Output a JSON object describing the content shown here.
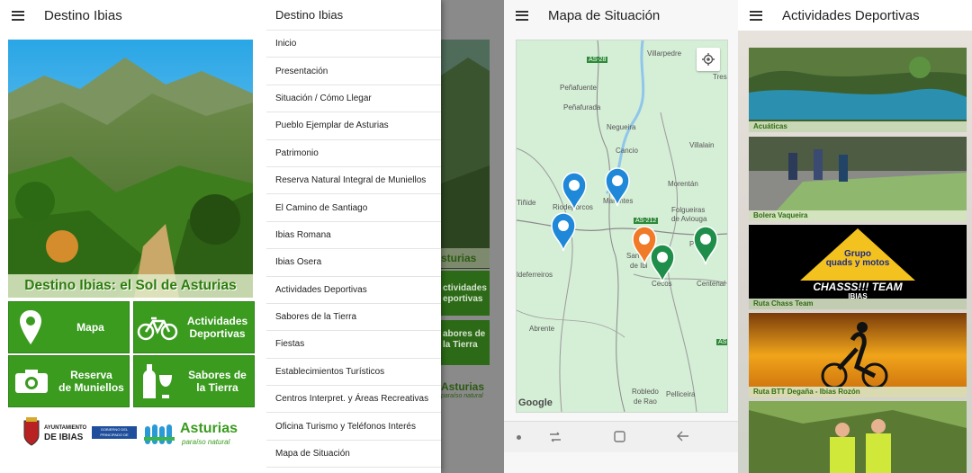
{
  "screen1": {
    "title": "Destino Ibias",
    "hero_caption": "Destino Ibias: el Sol de Asturias",
    "buttons": [
      {
        "label_line1": "Mapa",
        "label_line2": "",
        "icon": "map-marker-icon"
      },
      {
        "label_line1": "Actividades",
        "label_line2": "Deportivas",
        "icon": "bicycle-icon"
      },
      {
        "label_line1": "Reserva",
        "label_line2": "de Muniellos",
        "icon": "camera-icon"
      },
      {
        "label_line1": "Sabores de",
        "label_line2": "la Tierra",
        "icon": "bottle-glass-icon"
      }
    ],
    "logos": {
      "ayuntamiento_line1": "AYUNTAMIENTO",
      "ayuntamiento_line2": "DE IBIAS",
      "gobierno_line1": "GOBIERNO DEL",
      "gobierno_line2": "PRINCIPADO DE ASTURIAS",
      "asturias": "Asturias",
      "asturias_sub": "paraíso natural"
    },
    "colors": {
      "button_green": "#3a9b1f",
      "caption_green": "#2e7d0f"
    }
  },
  "screen2": {
    "drawer_title": "Destino Ibias",
    "menu_items": [
      "Inicio",
      "Presentación",
      "Situación / Cómo Llegar",
      "Pueblo Ejemplar de Asturias",
      "Patrimonio",
      "Reserva Natural Integral de Muniellos",
      "El Camino de Santiago",
      "Ibias Romana",
      "Ibias Osera",
      "Actividades Deportivas",
      "Sabores de la Tierra",
      "Fiestas",
      "Establecimientos Turísticos",
      "Centros Interpret. y Áreas Recreativas",
      "Oficina Turismo y Teléfonos Interés",
      "Mapa de Situación"
    ],
    "behind_fragments": [
      "sturias",
      "ctividades",
      "eportivas",
      "abores de",
      "la Tierra",
      "Asturias",
      "paraíso natural"
    ]
  },
  "screen3": {
    "title": "Mapa de Situación",
    "places": [
      "AS-28",
      "Villarpedre",
      "Peñafuente",
      "Peñafurada",
      "Negueira",
      "Tres",
      "Villalain",
      "Cancio",
      "Morentán",
      "Marentes",
      "Folgueiras",
      "de Aviouga",
      "Riodeporcos",
      "Tiñide",
      "AS-212",
      "Pr",
      "San",
      "de Ibi",
      "Cecos",
      "Centenal",
      "ldeferreiros",
      "Abrente",
      "AS-2",
      "Robledo",
      "de Rao",
      "Pelliceira"
    ],
    "map_attribution": "Google",
    "colors": {
      "pin_blue": "#1f88d8",
      "pin_orange": "#f07a28",
      "pin_green": "#1e8e4a",
      "map_bg": "#d7efd9"
    }
  },
  "screen4": {
    "title": "Actividades Deportivas",
    "tiles": [
      {
        "caption": "Acuáticas"
      },
      {
        "caption": "Bolera Vaqueira"
      },
      {
        "caption": "Ruta Chass Team",
        "logo_line1": "Grupo",
        "logo_line2": "quads y motos",
        "logo_line3": "CHASSS!!! TEAM",
        "logo_line4": "IBIAS"
      },
      {
        "caption": "Ruta BTT Degaña - Ibias Rozón"
      },
      {
        "caption": ""
      }
    ]
  }
}
